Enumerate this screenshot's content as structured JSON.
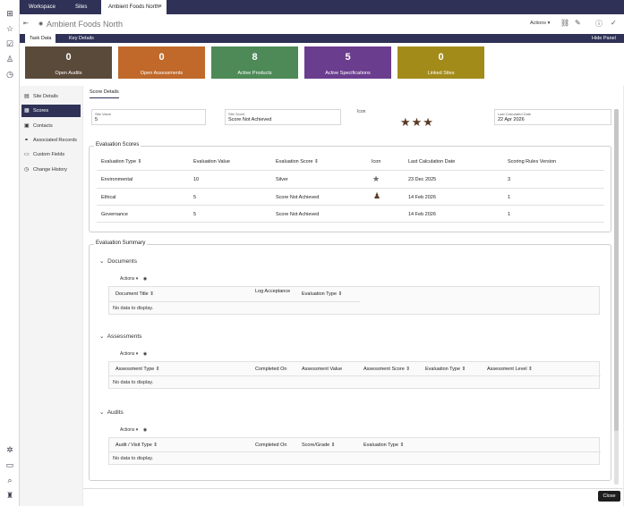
{
  "tabs": {
    "workspace": "Workspace",
    "sites": "Sites",
    "record": "Ambient Foods North",
    "close": "×"
  },
  "header": {
    "title": "Ambient Foods North",
    "actions": "Actions"
  },
  "subtabs": {
    "task_data": "Task Data",
    "key_details": "Key Details",
    "hide_panel": "Hide Panel"
  },
  "cards": [
    {
      "value": "0",
      "label": "Open Audits",
      "color": "#5a4a3a"
    },
    {
      "value": "0",
      "label": "Open Assessments",
      "color": "#c0692a"
    },
    {
      "value": "8",
      "label": "Active Products",
      "color": "#4d8a57"
    },
    {
      "value": "5",
      "label": "Active Specifications",
      "color": "#6b3d8e"
    },
    {
      "value": "0",
      "label": "Linked Sites",
      "color": "#a38b1a"
    }
  ],
  "sidebar": {
    "items": [
      {
        "label": "Site Details",
        "icon": "document-icon"
      },
      {
        "label": "Scores",
        "icon": "scores-icon"
      },
      {
        "label": "Contacts",
        "icon": "contact-icon"
      },
      {
        "label": "Associated Records",
        "icon": "link-icon"
      },
      {
        "label": "Custom Fields",
        "icon": "fields-icon"
      },
      {
        "label": "Change History",
        "icon": "history-icon"
      }
    ]
  },
  "score_tab": "Score Details",
  "fields": {
    "site_value_label": "Site Value",
    "site_value": "5",
    "site_score_label": "Site Score",
    "site_score": "Score Not Achieved",
    "icon_label": "Icon",
    "stars": "★★★",
    "stars_value": 3,
    "last_calc_label": "Last Calculated Date",
    "last_calc": "22 Apr 2026"
  },
  "eval_scores": {
    "title": "Evaluation Scores",
    "headers": [
      "Evaluation Type ⇕",
      "Evaluation Value",
      "Evaluation Score ⇕",
      "Icon",
      "Last Calculation Date",
      "Scoring Rules Version"
    ],
    "rows": [
      [
        "Environmental",
        "10",
        "Silver",
        "★",
        "23 Dec 2025",
        "3"
      ],
      [
        "Ethical",
        "5",
        "Score Not Achieved",
        "♟",
        "14 Feb 2026",
        "1"
      ],
      [
        "Governance",
        "5",
        "Score Not Achieved",
        "",
        "14 Feb 2026",
        "1"
      ]
    ]
  },
  "eval_summary": {
    "title": "Evaluation Summary",
    "actions": "Actions",
    "no_data": "No data to display.",
    "documents": {
      "title": "Documents",
      "headers": [
        "Document Title ⇕",
        "Log Acceptance",
        "Evaluation Type ⇕"
      ]
    },
    "assessments": {
      "title": "Assessments",
      "headers": [
        "Assessment Type ⇕",
        "Completed On",
        "Assessment Value",
        "Assessment Score ⇕",
        "Evaluation Type ⇕",
        "Assessment Level ⇕"
      ]
    },
    "audits": {
      "title": "Audits",
      "headers": [
        "Audit / Visit Type ⇕",
        "Completed On",
        "Score/Grade ⇕",
        "Evaluation Type ⇕"
      ]
    }
  },
  "close_label": "Close"
}
